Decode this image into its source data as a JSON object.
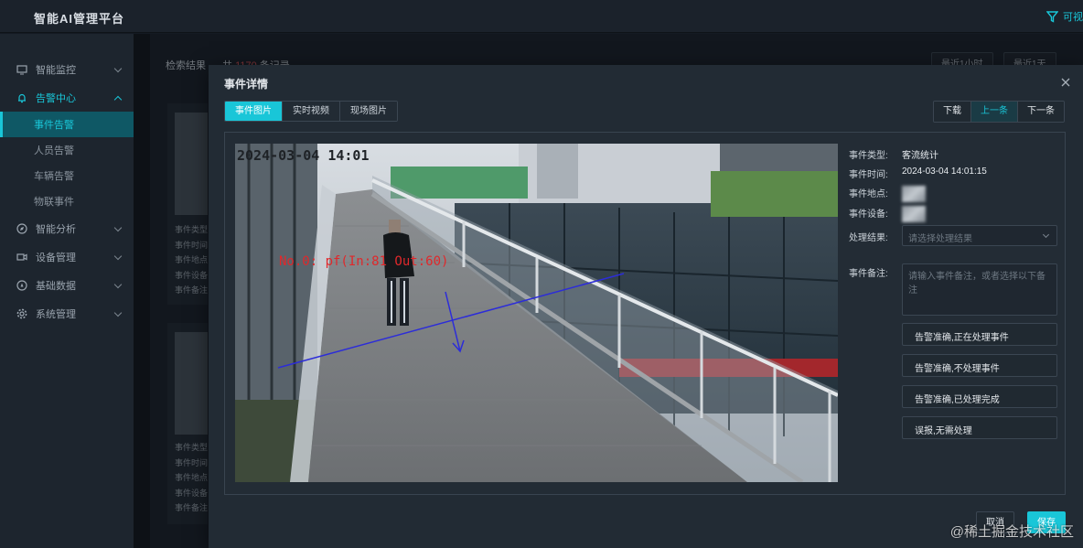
{
  "app": {
    "title": "智能AI管理平台",
    "top_right_label": "可视"
  },
  "sidebar": {
    "items": [
      {
        "label": "智能监控",
        "icon": "monitor-icon"
      },
      {
        "label": "告警中心",
        "icon": "bell-icon",
        "active": true,
        "children": [
          {
            "label": "事件告警",
            "active": true
          },
          {
            "label": "人员告警"
          },
          {
            "label": "车辆告警"
          },
          {
            "label": "物联事件"
          }
        ]
      },
      {
        "label": "智能分析",
        "icon": "compass-icon"
      },
      {
        "label": "设备管理",
        "icon": "camera-icon"
      },
      {
        "label": "基础数据",
        "icon": "compass2-icon"
      },
      {
        "label": "系统管理",
        "icon": "gear-icon"
      }
    ]
  },
  "background": {
    "results_label": "检索结果",
    "count_prefix": "共",
    "count": "1170",
    "count_suffix": "条记录",
    "filter_buttons": [
      "最近1小时",
      "最近1天"
    ],
    "card_lines": [
      "事件类型",
      "事件时间",
      "事件地点",
      "事件设备",
      "事件备注"
    ]
  },
  "modal": {
    "title": "事件详情",
    "tabs": [
      "事件图片",
      "实时视频",
      "现场图片"
    ],
    "nav": {
      "download": "下载",
      "prev": "上一条",
      "next": "下一条"
    },
    "image": {
      "timestamp": "2024-03-04 14:01",
      "overlay_text": "No.0: pf(In:81 Out:60)"
    },
    "details": {
      "type_label": "事件类型:",
      "type_value": "客流统计",
      "time_label": "事件时间:",
      "time_value": "2024-03-04 14:01:15",
      "location_label": "事件地点:",
      "device_label": "事件设备:",
      "result_label": "处理结果:",
      "result_placeholder": "请选择处理结果",
      "remark_label": "事件备注:",
      "remark_placeholder": "请输入事件备注，或者选择以下备注"
    },
    "quick_remarks": [
      "告警准确,正在处理事件",
      "告警准确,不处理事件",
      "告警准确,已处理完成",
      "误报,无需处理"
    ],
    "footer": {
      "cancel": "取消",
      "save": "保存"
    }
  },
  "watermark": "@稀土掘金技术社区",
  "colors": {
    "accent": "#19c6d8",
    "overlay_red": "#e0282b",
    "line_blue": "#2c2cd9"
  }
}
